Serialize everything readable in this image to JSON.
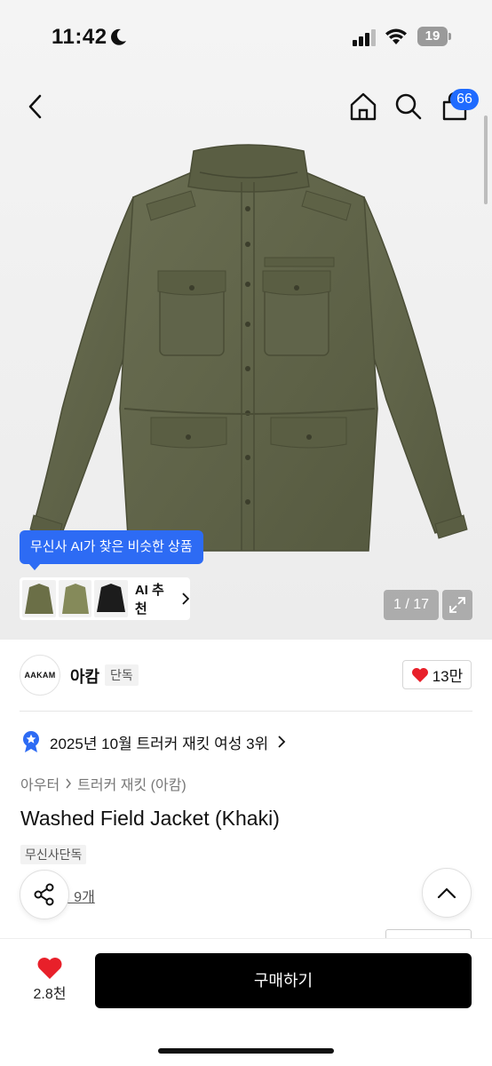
{
  "status_bar": {
    "time": "11:42",
    "battery": "19",
    "icons": [
      "moon-icon",
      "signal-icon",
      "wifi-icon",
      "battery-icon"
    ]
  },
  "nav": {
    "icons": [
      "chevron-left-icon",
      "home-icon",
      "search-icon",
      "cart-icon"
    ],
    "cart_count": "66"
  },
  "gallery": {
    "image_subject": "khaki field jacket",
    "ai_tooltip": "무신사 AI가 찾은 비슷한 상품",
    "ai_recommend_label": "AI 추천",
    "counter": "1 / 17"
  },
  "brand": {
    "logo_text": "AAKAM",
    "name": "아캄",
    "exclusive_tag": "단독",
    "like_count": "13만"
  },
  "ranking": {
    "text": "2025년 10월 트러커 재킷 여성 3위"
  },
  "category": {
    "parent": "아우터",
    "child": "트러커 재킷 (아캄)"
  },
  "product": {
    "title": "Washed Field Jacket (Khaki)",
    "tag": "무신사단독",
    "review_link": "기 9개"
  },
  "bottom_bar": {
    "like_count": "2.8천",
    "buy_label": "구매하기"
  },
  "colors": {
    "accent_blue": "#2d6bf4",
    "badge_blue": "#1f6bff",
    "like_red": "#e8202a",
    "jacket_khaki": "#5f6348",
    "buy_button": "#000000"
  }
}
